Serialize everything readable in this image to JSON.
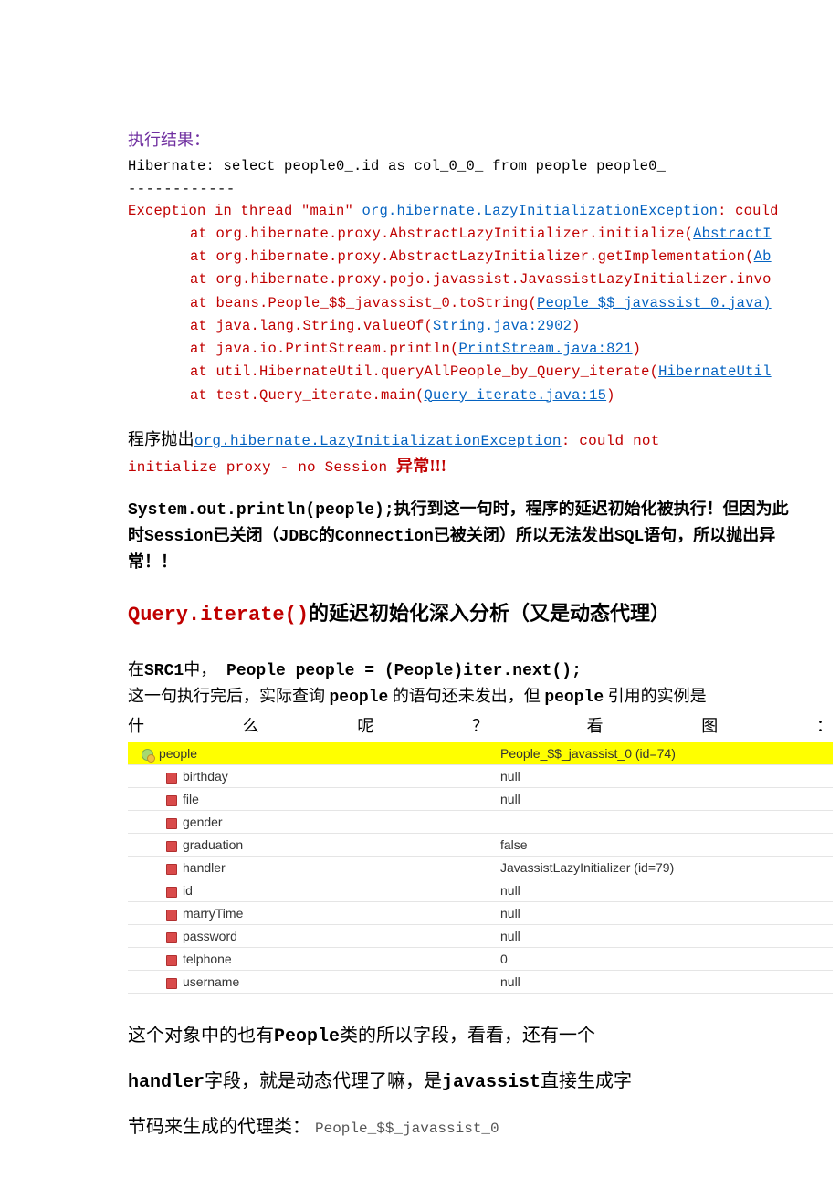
{
  "intro": "执行结果：",
  "sql_line": "Hibernate: select people0_.id as col_0_0_ from people people0_",
  "dashes": "------------",
  "exc_prefix": "Exception in thread \"main\" ",
  "exc_class": "org.hibernate.LazyInitializationException",
  "exc_suffix": ": could",
  "stack": [
    {
      "text": "at org.hibernate.proxy.AbstractLazyInitializer.initialize(",
      "link": "AbstractI"
    },
    {
      "text": "at org.hibernate.proxy.AbstractLazyInitializer.getImplementation(",
      "link": "Ab"
    },
    {
      "text": "at org.hibernate.proxy.pojo.javassist.JavassistLazyInitializer.invo",
      "link": ""
    },
    {
      "text": "at beans.People_$$_javassist_0.toString(",
      "link": "People_$$_javassist_0.java)"
    },
    {
      "text": "at java.lang.String.valueOf(",
      "link": "String.java:2902",
      "close": ")"
    },
    {
      "text": "at java.io.PrintStream.println(",
      "link": "PrintStream.java:821",
      "close": ")"
    },
    {
      "text": "at util.HibernateUtil.queryAllPeople_by_Query_iterate(",
      "link": "HibernateUtil"
    },
    {
      "text": "at test.Query_iterate.main(",
      "link": "Query_iterate.java:15",
      "close": ")"
    }
  ],
  "throw_para": {
    "prefix": "程序抛出",
    "link": "org.hibernate.LazyInitializationException",
    "red1": ": could not ",
    "red2": "initialize proxy - no Session ",
    "tail": "异常!!!"
  },
  "explain": {
    "code1": "System.out.println(people);",
    "t1": "执行到这一句时，程序的延迟初始化被执行！但因为此时",
    "c2": "Session",
    "t2": "已关闭（",
    "c3": "JDBC",
    "t3": "的",
    "c4": "Connection",
    "t4": "已被关闭）所以无法发出",
    "c5": "SQL",
    "t5": "语句，所以抛出异常！！"
  },
  "h2": {
    "red": "Query.iterate()",
    "black": "的延迟初始化深入分析（又是动态代理）"
  },
  "src_para": {
    "pre": "在",
    "c1": "SRC1",
    "mid1": "中，",
    "code": " People people = (People)iter.next();",
    "line2a": "这一句执行完后，实际查询 ",
    "c2": "people",
    "line2b": " 的语句还未发出，但 ",
    "c3": "people",
    "line2c": " 引用的实例是"
  },
  "spread": [
    "什",
    "么",
    "呢",
    "？",
    "看",
    "图",
    "："
  ],
  "debug_rows": [
    {
      "level": 0,
      "icon": "obj",
      "key": "people",
      "val": "People_$$_javassist_0  (id=74)",
      "hl": true
    },
    {
      "level": 1,
      "icon": "field",
      "key": "birthday",
      "val": "null"
    },
    {
      "level": 1,
      "icon": "field",
      "key": "file",
      "val": "null"
    },
    {
      "level": 1,
      "icon": "field",
      "key": "gender",
      "val": ""
    },
    {
      "level": 1,
      "icon": "field",
      "key": "graduation",
      "val": "false"
    },
    {
      "level": 1,
      "icon": "field",
      "key": "handler",
      "val": "JavassistLazyInitializer  (id=79)"
    },
    {
      "level": 1,
      "icon": "field",
      "key": "id",
      "val": "null"
    },
    {
      "level": 1,
      "icon": "field",
      "key": "marryTime",
      "val": "null"
    },
    {
      "level": 1,
      "icon": "field",
      "key": "password",
      "val": "null"
    },
    {
      "level": 1,
      "icon": "field",
      "key": "telphone",
      "val": "0"
    },
    {
      "level": 1,
      "icon": "field",
      "key": "username",
      "val": "null"
    }
  ],
  "closing": {
    "l1a": "这个对象中的也有",
    "l1b": "People",
    "l1c": "类的所以字段，看看，还有一个",
    "l2a": "handler",
    "l2b": "字段，就是动态代理了嘛，是",
    "l2c": "javassist",
    "l2d": "直接生成字",
    "l3a": "节码来生成的代理类： ",
    "l3b": "People_$$_javassist_0"
  }
}
